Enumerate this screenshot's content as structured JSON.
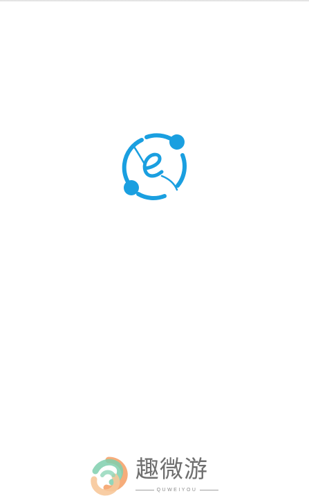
{
  "splash": {
    "logo_icon": "e-orbit-logo-icon",
    "logo_color": "#1a9fe0"
  },
  "brand": {
    "mark_icon": "quweiyou-knot-logo-icon",
    "name": "趣微游",
    "subtitle": "QUWEIYOU",
    "mark_colors": [
      "#7fcfae",
      "#f5a36b",
      "#f7c89a"
    ]
  }
}
